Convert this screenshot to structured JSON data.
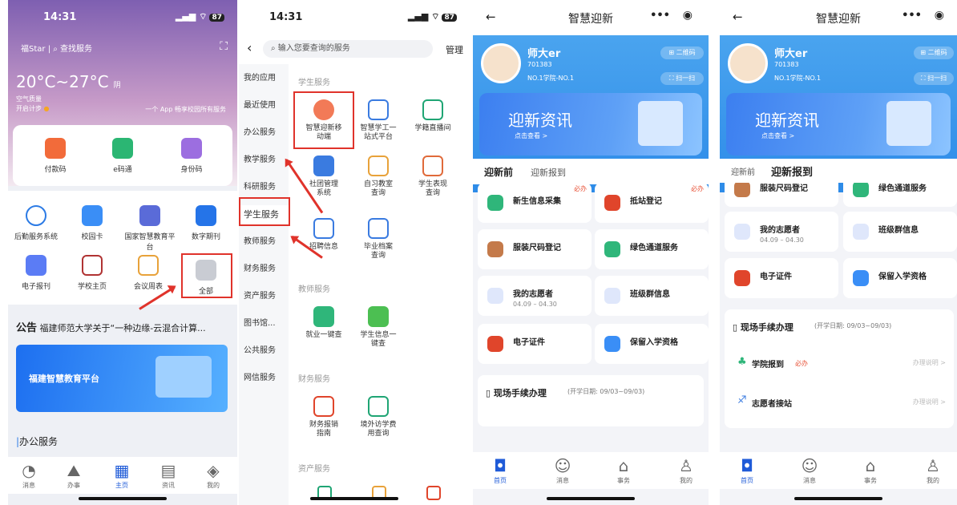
{
  "p1": {
    "time": "14:31",
    "sig": "∙∙∙l ≈",
    "battery": "87",
    "location": "福Star",
    "search": "查找服务",
    "temp": "20°C~27°C",
    "weather": "阴",
    "air": "空气质量",
    "step": "开启计步",
    "slogan": "一个 App 畅享校园所有服务",
    "cards": [
      {
        "label": "付款码"
      },
      {
        "label": "e码通"
      },
      {
        "label": "身份码"
      }
    ],
    "grid": [
      {
        "label": "后勤服务系统"
      },
      {
        "label": "校园卡"
      },
      {
        "label": "国家智慧教育平台"
      },
      {
        "label": "数字期刊"
      },
      {
        "label": "电子报刊"
      },
      {
        "label": "学校主页"
      },
      {
        "label": "会议周表"
      },
      {
        "label": "全部"
      }
    ],
    "notice_tag": "公告",
    "notice": "福建师范大学关于“一种边缘-云混合计算...",
    "promo": "福建智慧教育平台",
    "section": "办公服务",
    "tabs": [
      "消息",
      "办事",
      "主页",
      "资讯",
      "我的"
    ]
  },
  "p2": {
    "time": "14:31",
    "battery": "87",
    "search": "输入您要查询的服务",
    "manage": "管理",
    "menu": [
      "我的应用",
      "最近使用",
      "办公服务",
      "教学服务",
      "科研服务",
      "学生服务",
      "教师服务",
      "财务服务",
      "资产服务",
      "图书馆...",
      "公共服务",
      "网信服务"
    ],
    "sec1": "学生服务",
    "items1": [
      [
        "智慧迎新移",
        "动端"
      ],
      [
        "智慧学工一",
        "站式平台"
      ],
      [
        "学籍直播间",
        ""
      ],
      [
        "社团管理",
        "系统"
      ],
      [
        "自习教室",
        "查询"
      ],
      [
        "学生表现",
        "查询"
      ],
      [
        "招聘信息",
        ""
      ],
      [
        "毕业档案",
        "查询"
      ]
    ],
    "sec2": "教师服务",
    "items2": [
      [
        "就业一键查",
        ""
      ],
      [
        "学生信息一",
        "键查"
      ]
    ],
    "sec3": "财务服务",
    "items3": [
      [
        "财务报销",
        "指南"
      ],
      [
        "境外访学费",
        "用查询"
      ]
    ],
    "sec4": "资产服务"
  },
  "p3": {
    "title": "智慧迎新",
    "name": "师大er",
    "id": "701383",
    "college": "NO.1学院-NO.1",
    "qr": "二维码",
    "scan": "扫一扫",
    "banner": "迎新资讯",
    "banner_sub": "点击查看 >",
    "tab1": "迎新前",
    "tab2": "迎新报到",
    "must": "必办",
    "items": [
      {
        "label": "新生信息采集",
        "sub": ""
      },
      {
        "label": "抵站登记",
        "sub": ""
      },
      {
        "label": "服装尺码登记",
        "sub": ""
      },
      {
        "label": "绿色通道服务",
        "sub": ""
      },
      {
        "label": "我的志愿者",
        "sub": "04.09 – 04.30"
      },
      {
        "label": "班级群信息",
        "sub": ""
      },
      {
        "label": "电子证件",
        "sub": ""
      },
      {
        "label": "保留入学资格",
        "sub": ""
      }
    ],
    "onsite": "现场手续办理",
    "onsite_date": "(开学日期: 09/03~09/03)",
    "tabs": [
      "首页",
      "消息",
      "事务",
      "我的"
    ]
  },
  "p4": {
    "title": "智慧迎新",
    "name": "师大er",
    "id": "701383",
    "college": "NO.1学院-NO.1",
    "qr": "二维码",
    "scan": "扫一扫",
    "banner": "迎新资讯",
    "banner_sub": "点击查看 >",
    "tab1": "迎新前",
    "tab2": "迎新报到",
    "cut": [
      "服装尺码登记",
      "绿色通道服务"
    ],
    "items": [
      {
        "label": "我的志愿者",
        "sub": "04.09 – 04.30"
      },
      {
        "label": "班级群信息",
        "sub": ""
      },
      {
        "label": "电子证件",
        "sub": ""
      },
      {
        "label": "保留入学资格",
        "sub": ""
      }
    ],
    "onsite": "现场手续办理",
    "onsite_date": "(开学日期: 09/03~09/03)",
    "rows": [
      {
        "label": "学院报到",
        "must": "必办",
        "hint": "办理说明 >"
      },
      {
        "label": "志愿者接站",
        "hint": "办理说明 >"
      }
    ],
    "tabs": [
      "首页",
      "消息",
      "事务",
      "我的"
    ]
  }
}
